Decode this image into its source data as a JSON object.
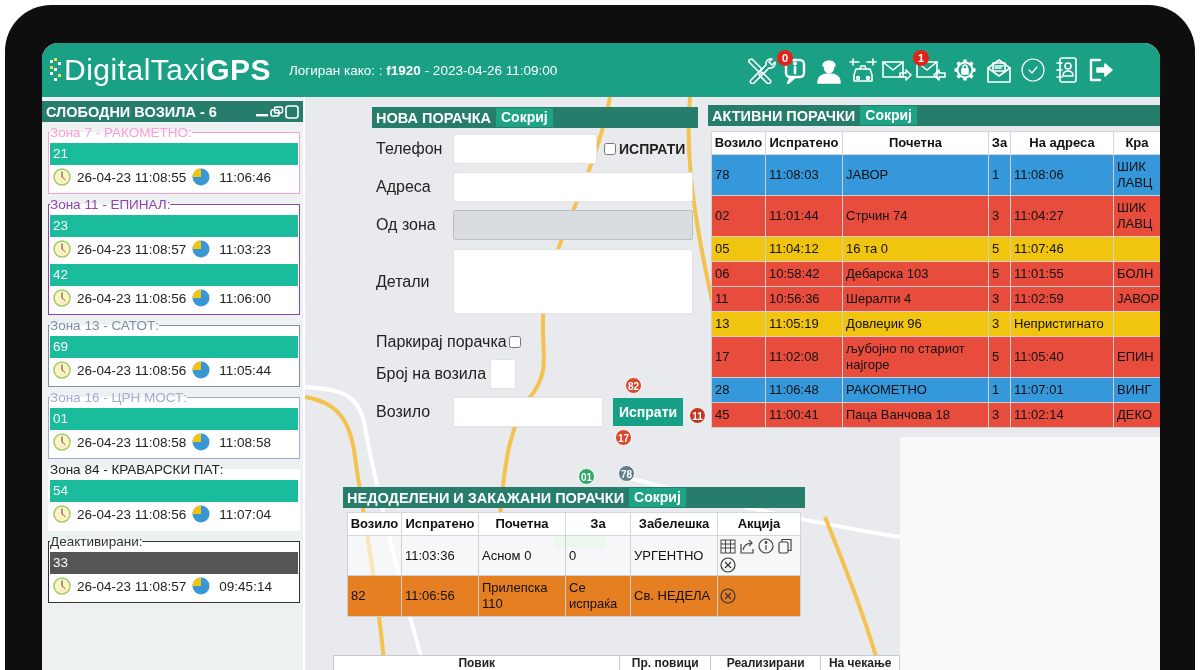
{
  "header": {
    "logo": "DigitalTaxi**GPS**",
    "login_info": "Логиран како: : **f1920** - 2023-04-26 11:09:00",
    "toolbar": [
      {
        "kind": "tools"
      },
      {
        "kind": "messages",
        "badge": "0"
      },
      {
        "kind": "driver"
      },
      {
        "kind": "taxi"
      },
      {
        "kind": "mail_out"
      },
      {
        "kind": "mail_in",
        "badge": "1"
      },
      {
        "kind": "settings"
      },
      {
        "kind": "mail_open"
      },
      {
        "kind": "check"
      },
      {
        "kind": "contacts"
      },
      {
        "kind": "logout"
      }
    ]
  },
  "free_vehicles": {
    "title": "СЛОБОДНИ ВОЗИЛА - 6",
    "zones": [
      {
        "label": "Зона 7 - РАКОМЕТНО:",
        "kind": "zone",
        "color": "#f7a1d6",
        "bordered": true,
        "vehicles": [
          {
            "number": "21",
            "timestamp": "26-04-23 11:08:55",
            "time": "11:06:46"
          }
        ]
      },
      {
        "label": "Зона 11 - ЕПИНАЛ:",
        "kind": "zone",
        "color": "#8e44ad",
        "bordered": true,
        "vehicles": [
          {
            "number": "23",
            "timestamp": "26-04-23 11:08:57",
            "time": "11:03:23"
          },
          {
            "number": "42",
            "timestamp": "26-04-23 11:08:56",
            "time": "11:06:00"
          }
        ]
      },
      {
        "label": "Зона 13 - САТОТ:",
        "kind": "zone",
        "color": "#7d8fa3",
        "bordered": true,
        "vehicles": [
          {
            "number": "69",
            "timestamp": "26-04-23 11:08:56",
            "time": "11:05:44"
          }
        ]
      },
      {
        "label": "Зона 16 - ЦРН МОСТ:",
        "kind": "zone",
        "color": "#a2acd2",
        "bordered": true,
        "vehicles": [
          {
            "number": "01",
            "timestamp": "26-04-23 11:08:58",
            "time": "11:08:58"
          }
        ]
      },
      {
        "label": "Зона 84 - КРАВАРСКИ ПАТ:",
        "kind": "zone",
        "color": "#222222",
        "bordered": false,
        "vehicles": [
          {
            "number": "54",
            "timestamp": "26-04-23 11:08:56",
            "time": "11:07:04"
          }
        ]
      },
      {
        "label": "Деактивирани:",
        "kind": "deactivated",
        "color": "#333333",
        "bordered": true,
        "vehicles": [
          {
            "number": "33",
            "timestamp": "26-04-23 11:08:57",
            "time": "09:45:14"
          }
        ]
      }
    ]
  },
  "map": {
    "markers": [
      {
        "label": "82",
        "color": "#d9482b"
      },
      {
        "label": "11",
        "color": "#c23a22"
      },
      {
        "label": "17",
        "color": "#d9482b"
      },
      {
        "label": "01",
        "color": "#2fa866"
      },
      {
        "label": "78",
        "color": "#5f7d8c"
      }
    ]
  },
  "new_order": {
    "title": "НОВА ПОРАЧКА",
    "hide_button": "Сокриј",
    "fields": [
      {
        "kind": "text",
        "label": "Телефон",
        "disabled": false,
        "checkbox": {
          "label": "ИСПРАТИ",
          "checked": false
        }
      },
      {
        "kind": "text",
        "label": "Адреса",
        "disabled": false
      },
      {
        "kind": "text",
        "label": "Од зона",
        "disabled": true
      },
      {
        "kind": "textarea",
        "label": "Детали",
        "disabled": false
      },
      {
        "kind": "checkbox",
        "label": "Паркирај порачка",
        "disabled": false,
        "checked": false
      },
      {
        "kind": "number",
        "label": "Број на возила",
        "disabled": false
      },
      {
        "kind": "text",
        "label": "Возило",
        "disabled": false,
        "button": "Испрати"
      }
    ]
  },
  "active_orders": {
    "title": "АКТИВНИ ПОРАЧКИ",
    "hide_button": "Сокриј",
    "columns": [
      "Возило",
      "Испратено",
      "Почетна",
      "За",
      "На адреса",
      "Кра"
    ],
    "rows": [
      {
        "color": "#3498db",
        "vehicle": "78",
        "dispatched": "11:08:03",
        "pickup": "ЈАВОР",
        "za": "1",
        "at_address": "11:08:06",
        "column_6": "ШИК ЛАВЦ"
      },
      {
        "color": "#e74c3c",
        "vehicle": "02",
        "dispatched": "11:01:44",
        "pickup": "Стрчин 74",
        "za": "3",
        "at_address": "11:04:27",
        "column_6": "ШИК ЛАВЦ"
      },
      {
        "color": "#f1c40f",
        "vehicle": "05",
        "dispatched": "11:04:12",
        "pickup": "16 та 0",
        "za": "5",
        "at_address": "11:07:46"
      },
      {
        "color": "#e74c3c",
        "vehicle": "06",
        "dispatched": "10:58:42",
        "pickup": "Дебарска 103",
        "za": "5",
        "at_address": "11:01:55",
        "column_6": "БОЛН"
      },
      {
        "color": "#e74c3c",
        "vehicle": "11",
        "dispatched": "10:56:36",
        "pickup": "Шералти 4",
        "za": "3",
        "at_address": "11:02:59",
        "column_6": "ЈАВОР"
      },
      {
        "color": "#f1c40f",
        "vehicle": "13",
        "dispatched": "11:05:19",
        "pickup": "Довлеџик 96",
        "za": "3",
        "at_address": "Непристигнато"
      },
      {
        "color": "#e74c3c",
        "vehicle": "17",
        "dispatched": "11:02:08",
        "pickup": "љубојно по стариот најгоре",
        "za": "5",
        "at_address": "11:05:40",
        "column_6": "ЕПИН"
      },
      {
        "color": "#3498db",
        "vehicle": "28",
        "dispatched": "11:06:48",
        "pickup": "РАКОМЕТНО",
        "za": "1",
        "at_address": "11:07:01",
        "column_6": "ВИНГ"
      },
      {
        "color": "#e74c3c",
        "vehicle": "45",
        "dispatched": "11:00:41",
        "pickup": "Паца Ванчова 18",
        "za": "3",
        "at_address": "11:02:14",
        "column_6": "ДЕКО"
      }
    ]
  },
  "unassigned_orders": {
    "title": "НЕДОДЕЛЕНИ И ЗАКАЖАНИ ПОРАЧКИ",
    "hide_button": "Сокриј",
    "columns": [
      "Возило",
      "Испратено",
      "Почетна",
      "За",
      "Забелешка",
      "Акција"
    ],
    "rows": [
      {
        "kind": "scheduled",
        "dispatched": "11:03:36",
        "pickup": "Асном 0",
        "za": "0",
        "note": "УРГЕНТНО"
      },
      {
        "kind": "dispatching",
        "color": "#e67e22",
        "vehicle": "82",
        "dispatched": "11:06:56",
        "pickup": "Прилепска 110",
        "za": "Се испраќа",
        "note": "Св. НЕДЕЛА"
      }
    ]
  },
  "stats": {
    "columns": [
      "Повик",
      "Пр. повици",
      "Реализирани",
      "На чекање"
    ]
  }
}
